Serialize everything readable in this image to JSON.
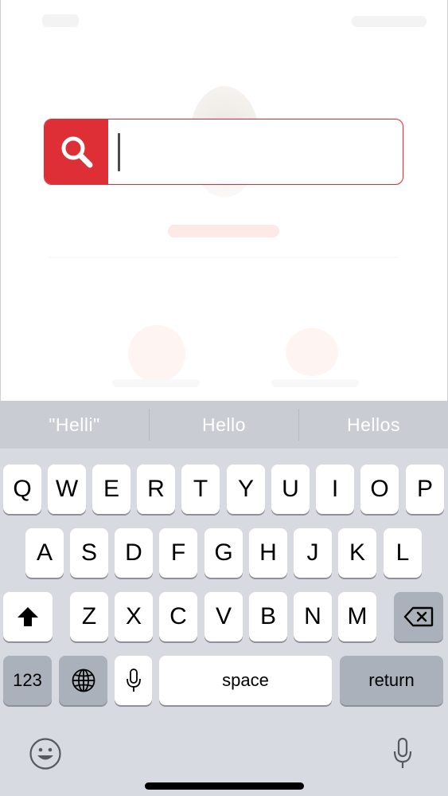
{
  "search": {
    "value": "",
    "placeholder": "",
    "accent_color": "#dd2f35"
  },
  "suggestions": [
    "\"Helli\"",
    "Hello",
    "Hellos"
  ],
  "keyboard": {
    "row1": [
      "Q",
      "W",
      "E",
      "R",
      "T",
      "Y",
      "U",
      "I",
      "O",
      "P"
    ],
    "row2": [
      "A",
      "S",
      "D",
      "F",
      "G",
      "H",
      "J",
      "K",
      "L"
    ],
    "row3": [
      "Z",
      "X",
      "C",
      "V",
      "B",
      "N",
      "M"
    ],
    "numbers_label": "123",
    "space_label": "space",
    "return_label": "return",
    "icons": {
      "shift": "shift-arrow-icon",
      "delete": "backspace-icon",
      "globe": "globe-icon",
      "dictation": "microphone-icon",
      "emoji": "emoji-face-icon"
    }
  },
  "colors": {
    "keyboard_bg": "#d7dae0",
    "suggestion_bg": "#c9cdd3",
    "key_dark": "#abb1ba",
    "key_light": "#ffffff"
  }
}
